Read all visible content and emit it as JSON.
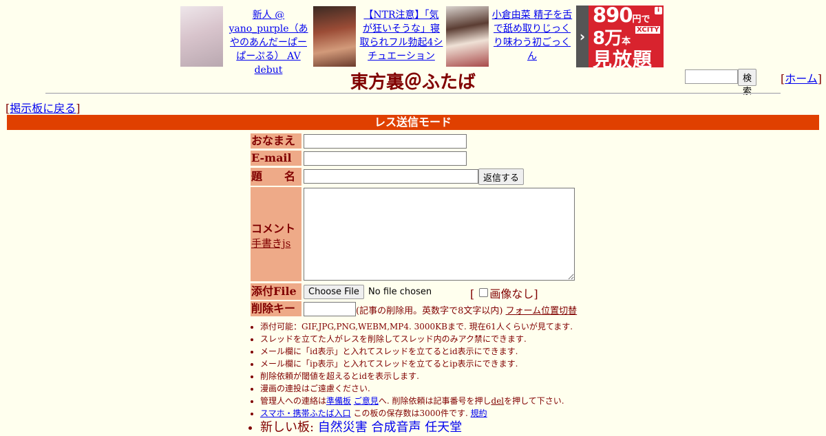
{
  "ads": {
    "items": [
      {
        "text": "新人 @ yano_purple（あやのあんだーぱーぱーぷる） AV debut",
        "thumb_color": "#d9c9cf"
      },
      {
        "text": "【NTR注意】「気が狂いそうな」寝取られフル勃起4シチュエーション",
        "thumb_color": "#7a3a2a"
      },
      {
        "text": "小倉由菜 精子を舌で舐め取りじっくり味わう初ごっくん",
        "thumb_color": "#c9c2bd"
      }
    ],
    "banner": {
      "line1": "890",
      "line1_unit": "円で",
      "line2": "8万",
      "line2_unit": "本",
      "brand": "XCITY",
      "line3": "見放題",
      "color": "#d8232e"
    }
  },
  "header": {
    "title": "東方裏＠ふたば",
    "search_button": "検索",
    "home_link": "ホーム",
    "back_link": "掲示板に戻る"
  },
  "mode_bar": "レス送信モード",
  "form": {
    "name_label": "おなまえ",
    "email_label": "E-mail",
    "subject_label": "題　　名",
    "submit_button": "返信する",
    "comment_label": "コメント",
    "handwriting_link": "手書きjs",
    "file_label": "添付File",
    "choose_file_button": "Choose File",
    "no_file_text": "No file chosen",
    "no_image_label": "画像なし",
    "delete_key_label": "削除キー",
    "delete_key_note": "(記事の削除用。英数字で8文字以内)",
    "form_position_link": "フォーム位置切替"
  },
  "rules": {
    "r1": "添付可能：GIF,JPG,PNG,WEBM,MP4. 3000KBまで. 現在61人くらいが見てます.",
    "r2": "スレッドを立てた人がレスを削除してスレッド内のみアク禁にできます.",
    "r3": "メール欄に「id表示」と入れてスレッドを立てるとid表示にできます.",
    "r4": "メール欄に「ip表示」と入れてスレッドを立てるとip表示にできます.",
    "r5": "削除依頼が閾値を超えるとidを表示します.",
    "r6": "漫画の連投はご遠慮ください.",
    "r7_pre": "管理人への連絡は",
    "r7_link1": "準備板",
    "r7_link2": "ご意見",
    "r7_mid": "へ. 削除依頼は記事番号を押し",
    "r7_link3": "del",
    "r7_post": "を押して下さい.",
    "r8_link": "スマホ・携帯ふたば入口",
    "r8_text": " この板の保存数は3000件です. ",
    "r8_link2": "規約",
    "r9_label": "新しい板: ",
    "r9_boards": [
      "自然災害",
      "合成音声",
      "任天堂"
    ]
  }
}
